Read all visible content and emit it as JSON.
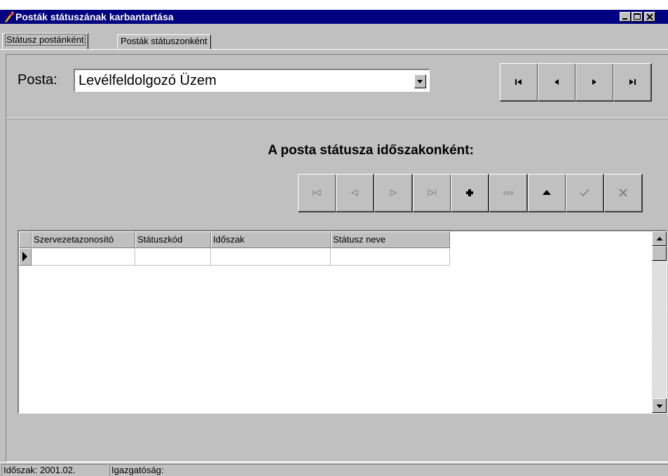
{
  "window": {
    "title": "Posták státuszának karbantartása"
  },
  "tabs": [
    {
      "label": "Státusz postánként",
      "active": true
    },
    {
      "label": "Posták státuszonként",
      "active": false
    }
  ],
  "posta_selector": {
    "label": "Posta:",
    "value": "Levélfeldolgozó Üzem"
  },
  "record_nav": {
    "buttons": [
      "first-record",
      "previous-record",
      "next-record",
      "last-record"
    ]
  },
  "section": {
    "heading": "A posta státusza időszakonként:"
  },
  "db_navigator": {
    "buttons": [
      {
        "name": "first",
        "enabled": false
      },
      {
        "name": "prior",
        "enabled": false
      },
      {
        "name": "next",
        "enabled": false
      },
      {
        "name": "last",
        "enabled": false
      },
      {
        "name": "insert",
        "enabled": true
      },
      {
        "name": "delete",
        "enabled": false
      },
      {
        "name": "edit",
        "enabled": true
      },
      {
        "name": "post",
        "enabled": false
      },
      {
        "name": "cancel",
        "enabled": false
      }
    ]
  },
  "grid": {
    "columns": [
      "Szervezetazonosító",
      "Státuszkód",
      "Időszak",
      "Státusz neve"
    ],
    "rows": [
      [
        "",
        "",
        "",
        ""
      ]
    ]
  },
  "statusbar": {
    "period": "Időszak: 2001.02.",
    "department": "Igazgatóság:"
  },
  "colors": {
    "titlebar": "#000080",
    "face": "#c0c0c0"
  }
}
